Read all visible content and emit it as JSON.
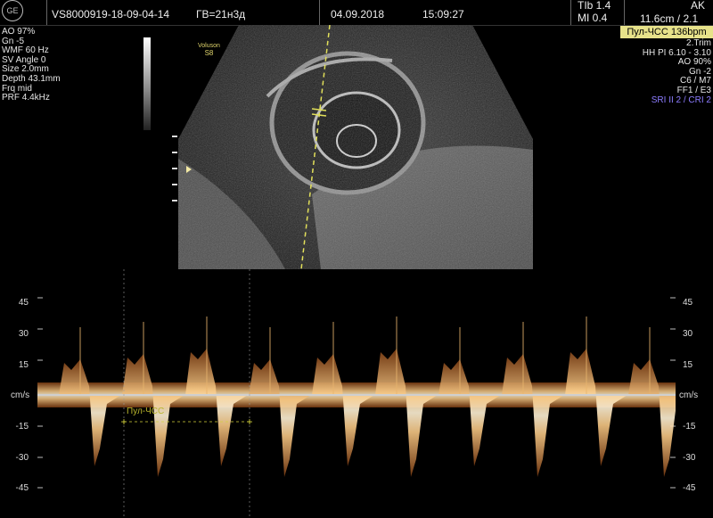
{
  "header": {
    "logo": "GE",
    "logo_icon": "ge-logo-icon",
    "patient_id": "VS8000919-18-09-04-14",
    "gestational_age": "ГВ=21н3д",
    "date": "04.09.2018",
    "time": "15:09:27",
    "tib": "TIb  1.4",
    "mi": "MI  0.4",
    "operator": "AK",
    "depth_freq": "11.6cm / 2.1"
  },
  "heart_rate_badge": "Пул-ЧСС 136bpm",
  "left_params": [
    "AO 97%",
    "Gn  -5",
    "WMF 60 Hz",
    "SV Angle  0",
    "Size  2.0mm",
    "Depth 43.1mm",
    "Frq mid",
    "PRF  4.4kHz"
  ],
  "right_params": [
    "2.Trim",
    "HH PI 6.10 - 3.10",
    "AO 90%",
    "Gn  -2",
    "C6 / M7",
    "FF1 / E3"
  ],
  "sri_label": "SRI II 2 / CRI 2",
  "colors": {
    "badge": "#e7e28a",
    "sri": "#8c7cff",
    "spectral": "#f4c27c",
    "caliper": "#d4d23c"
  },
  "bmode": {
    "voluson_label": "Voluson",
    "probe_label": "S8"
  },
  "doppler": {
    "axis_unit": "cm/s",
    "left_axis": [
      "45",
      "30",
      "15",
      "-15",
      "-30",
      "-45"
    ],
    "right_axis": [
      "45",
      "30",
      "15",
      "-15",
      "-30",
      "-45"
    ],
    "caliper_label": "Пул-ЧСС"
  }
}
